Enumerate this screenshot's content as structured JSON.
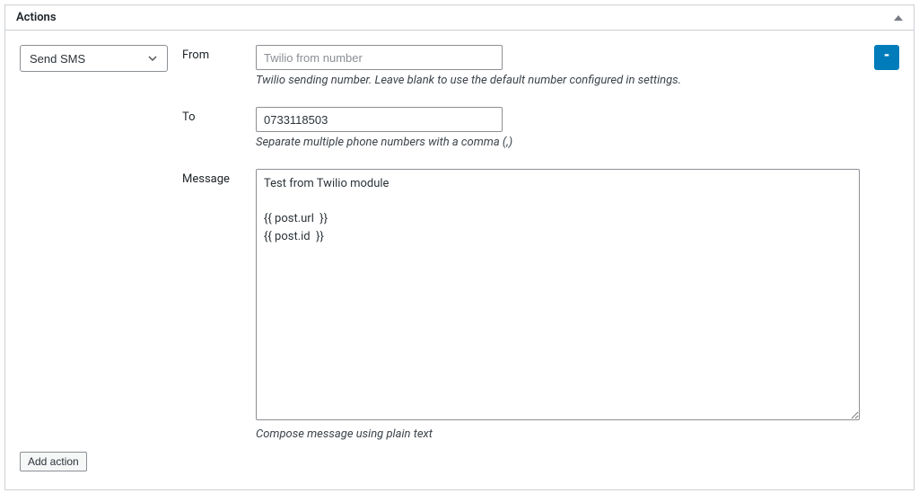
{
  "panel": {
    "title": "Actions"
  },
  "action": {
    "selected": "Send SMS",
    "remove_label": "-"
  },
  "fields": {
    "from": {
      "label": "From",
      "value": "",
      "placeholder": "Twilio from number",
      "help": "Twilio sending number. Leave blank to use the default number configured in settings."
    },
    "to": {
      "label": "To",
      "value": "0733118503",
      "placeholder": "",
      "help": "Separate multiple phone numbers with a comma (,)"
    },
    "message": {
      "label": "Message",
      "value": "Test from Twilio module\n\n{{ post.url  }}\n{{ post.id  }}",
      "help": "Compose message using plain text"
    }
  },
  "footer": {
    "add_action_label": "Add action"
  }
}
